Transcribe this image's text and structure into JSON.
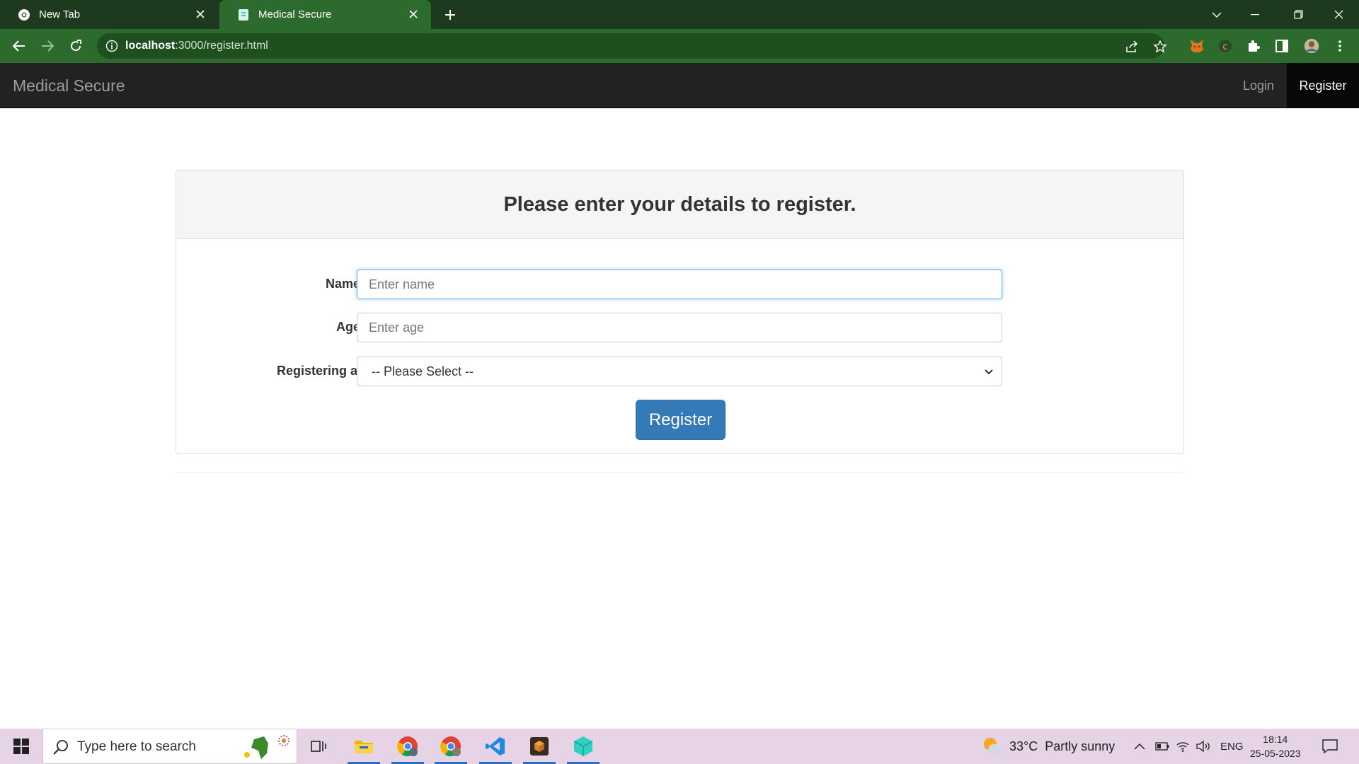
{
  "browser": {
    "tabs": [
      {
        "title": "New Tab",
        "active": false
      },
      {
        "title": "Medical Secure",
        "active": true
      }
    ],
    "url_host": "localhost",
    "url_path": ":3000/register.html"
  },
  "site": {
    "brand": "Medical Secure",
    "nav": {
      "login": "Login",
      "register": "Register"
    }
  },
  "form": {
    "heading": "Please enter your details to register.",
    "name_label": "Name:",
    "name_placeholder": "Enter name",
    "age_label": "Age:",
    "age_placeholder": "Enter age",
    "role_label": "Registering as",
    "role_selected": "-- Please Select --",
    "submit_label": "Register"
  },
  "taskbar": {
    "search_placeholder": "Type here to search",
    "weather_temp": "33°C",
    "weather_desc": "Partly sunny",
    "lang": "ENG",
    "time": "18:14",
    "date": "25-05-2023"
  },
  "colors": {
    "chrome_frame": "#1e3a1e",
    "chrome_toolbar": "#2d6a2d",
    "navbar": "#222222",
    "primary_button": "#337ab7",
    "taskbar": "#e6d3e6"
  }
}
